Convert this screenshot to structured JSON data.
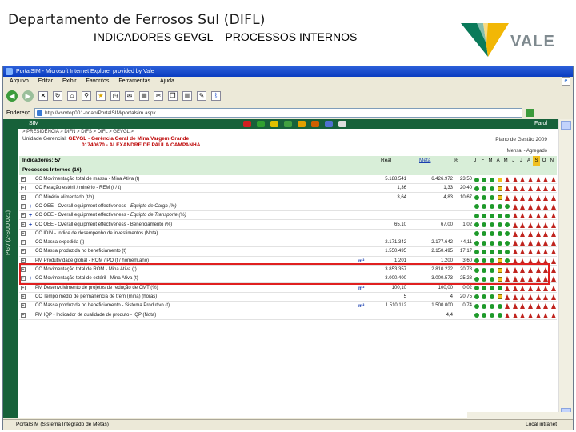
{
  "slide": {
    "title": "Departamento de Ferrosos Sul (DIFL)",
    "subtitle": "INDICADORES GEVGL – PROCESSOS INTERNOS",
    "logo_text": "VALE",
    "logo_colors": {
      "green": "#0a7a5a",
      "yellow": "#f2b705",
      "text": "#7f8a8f"
    }
  },
  "browser": {
    "title": "PortalSIM - Microsoft Internet Explorer provided by Vale",
    "menu": [
      "Arquivo",
      "Editar",
      "Exibir",
      "Favoritos",
      "Ferramentas",
      "Ajuda"
    ],
    "address_label": "Endereço",
    "address_value": "http://vsrvtop001-ndap/PortalSIM/portalsim.aspx",
    "status_text": "PortalSIM (Sistema Integrado de Metas)",
    "status_zone": "Local intranet"
  },
  "app": {
    "bar_label": "SIM",
    "farol_label": "Farol",
    "breadcrumb": "> PRESIDÊNCIA > DIFN > DIFS > DIFL > GEVGL >",
    "unit_prefix": "Unidade Gerencial:",
    "unit_code": "GEVGL",
    "unit_name": "- Gerência Geral de Mina Vargem Grande",
    "owner": "01740670 - ALEXANDRE DE PAULA CAMPANHA",
    "plan": "Plano de Gestão 2009",
    "mensal": "Mensal - Agregado",
    "side_label": "PGV (2-SUD 021)",
    "indicators_header": "Indicadores: 57",
    "process_header": "Processos Internos (16)",
    "col_real": "Real",
    "col_meta": "Meta",
    "col_pct": "%",
    "months": [
      "J",
      "F",
      "M",
      "A",
      "M",
      "J",
      "J",
      "A",
      "S",
      "O",
      "N",
      "D"
    ],
    "current_month_index": 8
  },
  "rows": [
    {
      "marker": "",
      "name": "CC Movimentação total de massa - Mina Ativa (t)",
      "real": "5.188.541",
      "meta": "6.426.972",
      "pct": "23,50",
      "lights": "gggyrrrrrrr-"
    },
    {
      "marker": "",
      "name": "CC Relação estéril / minério - REM (t / t)",
      "real": "1,36",
      "meta": "1,33",
      "pct": "20,40",
      "lights": "gggyrrrrrrr-"
    },
    {
      "marker": "",
      "name": "CC Minério alimentado (t/h)",
      "real": "3,64",
      "meta": "4,83",
      "pct": "10,67",
      "lights": "gggyrrrrrrr-"
    },
    {
      "marker": "+",
      "name": "CC OEE - Overall equipment effectiveness -",
      "name_italic": "Equipto de Carga (%)",
      "real": "",
      "meta": "",
      "pct": "",
      "lights": "gggggrrrrrr-"
    },
    {
      "marker": "+",
      "name": "CC OEE - Overall equipment effectiveness -",
      "name_italic": "Equipto de Transporte (%)",
      "real": "",
      "meta": "",
      "pct": "",
      "lights": "gggggrrrrrr-"
    },
    {
      "marker": "+",
      "name": "CC OEE - Overall equipment effectiveness - Beneficiamento (%)",
      "real": "65,10",
      "meta": "67,00",
      "pct": "1,02",
      "lights": "gggggrrrrrr-"
    },
    {
      "marker": "",
      "name": "CC IDIN - Índice de desempenho de investimentos (Nota)",
      "real": "",
      "meta": "",
      "pct": "",
      "lights": "gggggrrrrrr-"
    },
    {
      "marker": "",
      "name": "CC Massa expedida (t)",
      "real": "2.171.342",
      "meta": "2.177.642",
      "pct": "44,11",
      "lights": "gggggrrrrrr-"
    },
    {
      "marker": "",
      "name": "CC Massa produzida no beneficiamento (t)",
      "real": "1.550.495",
      "meta": "2.150.495",
      "pct": "17,17",
      "lights": "gggggrrrrrr-"
    },
    {
      "marker": "",
      "name": "PM Produtividade global - ROM / PO (t / homem.ano)",
      "chart": "m²",
      "real": "1.201",
      "meta": "1.200",
      "pct": "3,60",
      "lights": "gggygrrrrrr-"
    },
    {
      "marker": "",
      "name": "CC Movimentação total de ROM - Mina Ativa (t)",
      "real": "3.853.357",
      "meta": "2.810.222",
      "pct": "20,78",
      "lights": "gggyrrrrrrr-"
    },
    {
      "marker": "+",
      "name": "CC Movimentação total de estéril - Mina Ativa (t)",
      "real": "3.000.400",
      "meta": "3.000.573",
      "pct": "25,28",
      "lights": "gggyrrrrrrr-"
    },
    {
      "marker": "",
      "name": "PM Desenvolvimento de projetos de redução de CMT (%)",
      "chart": "m²",
      "real": "100,10",
      "meta": "100,00",
      "pct": "0,02",
      "lights": "ggggrrrrrrr-"
    },
    {
      "marker": "",
      "name": "CC Tempo médio de permanência de trem (mina) (horas)",
      "real": "5",
      "meta": "4",
      "pct": "20,75",
      "lights": "gggyrrrrrrr-"
    },
    {
      "marker": "",
      "name": "CC Massa produzida no beneficiamento - Sistema Produtivo (t)",
      "chart": "m²",
      "real": "1.510.112",
      "meta": "1.500.000",
      "pct": "0,74",
      "lights": "ggggrrrrrrr-"
    },
    {
      "marker": "",
      "name": "PM IQP - Indicador de qualidade de produto - IQP (Nota)",
      "real": "",
      "meta": "4,4",
      "pct": "",
      "lights": "ggggrrrrrrr-"
    }
  ]
}
